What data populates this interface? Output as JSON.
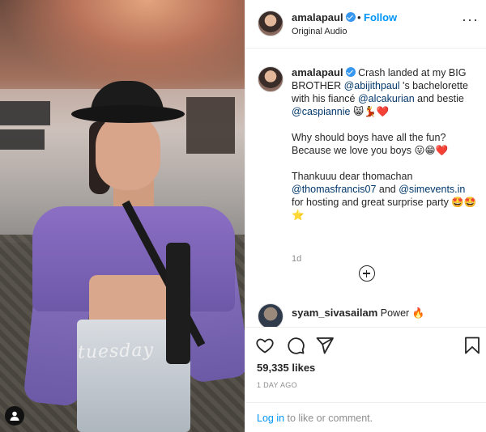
{
  "post": {
    "media": {
      "overlay_text": "tuesday",
      "user_icon": "user-silhouette-icon"
    },
    "header": {
      "username": "amalapaul",
      "separator": "•",
      "follow_label": "Follow",
      "audio_label": "Original Audio",
      "more_icon": "more-options-icon",
      "more_label": "···"
    },
    "caption": {
      "username": "amalapaul",
      "paragraph1": [
        {
          "t": "Crash landed at my BIG BROTHER "
        },
        {
          "m": "@abijithpaul"
        },
        {
          "t": " 's bachelorette with his fiancé "
        },
        {
          "m": "@alcakurian"
        },
        {
          "t": " and bestie "
        },
        {
          "m": "@caspiannie"
        },
        {
          "t": " 😸💃❤️"
        }
      ],
      "paragraph2": [
        {
          "t": "Why should boys have all the fun? Because we love you boys 😛😁❤️"
        }
      ],
      "paragraph3": [
        {
          "t": "Thankuuu dear thomachan "
        },
        {
          "m": "@thomasfrancis07"
        },
        {
          "t": " and "
        },
        {
          "m": "@simevents.in"
        },
        {
          "t": " for hosting and great surprise party 🤩🤩⭐"
        }
      ],
      "time": "1d"
    },
    "load_more_icon": "plus-circle-icon",
    "comment": {
      "username": "syam_sivasailam",
      "text": "Power 🔥"
    },
    "actions": {
      "like_icon": "heart-icon",
      "comment_icon": "comment-bubble-icon",
      "share_icon": "paper-plane-icon",
      "save_icon": "bookmark-icon",
      "likes": "59,335 likes",
      "posted": "1 DAY AGO"
    },
    "login": {
      "link": "Log in",
      "rest": " to like or comment."
    },
    "colors": {
      "accent": "#0095f6",
      "mention": "#00376b",
      "muted": "#8e8e8e",
      "verified": "#3897f0"
    }
  }
}
